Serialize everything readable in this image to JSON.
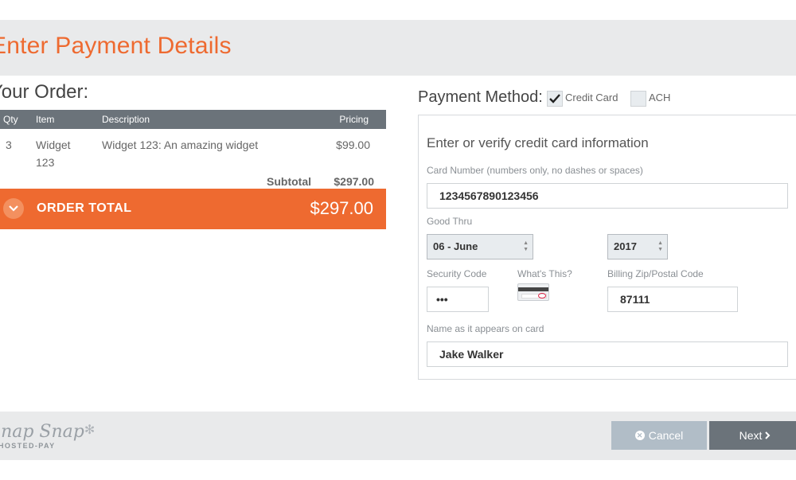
{
  "header": {
    "title": "Enter Payment Details"
  },
  "order": {
    "heading": "Your Order:",
    "columns": {
      "qty": "Qty",
      "item": "Item",
      "description": "Description",
      "pricing": "Pricing"
    },
    "rows": [
      {
        "qty": "3",
        "item_line1": "Widget",
        "item_line2": "123",
        "description": "Widget 123: An amazing widget",
        "price": "$99.00"
      }
    ],
    "subtotal_label": "Subtotal",
    "subtotal_value": "$297.00",
    "total_label": "ORDER TOTAL",
    "total_value": "$297.00",
    "expand_icon": "chevron-down-icon"
  },
  "payment": {
    "label": "Payment Method:",
    "options": [
      {
        "label": "Credit Card",
        "checked": true
      },
      {
        "label": "ACH",
        "checked": false
      }
    ]
  },
  "card_form": {
    "heading": "Enter or verify credit card information",
    "card_number_label": "Card Number (numbers only, no dashes or spaces)",
    "card_number_value": "1234567890123456",
    "good_thru_label": "Good Thru",
    "month_value": "06 - June",
    "year_value": "2017",
    "security_code_label": "Security Code",
    "security_code_value": "•••",
    "whats_this_label": "What's This?",
    "zip_label": "Billing Zip/Postal Code",
    "zip_value": "87111",
    "name_label": "Name as it appears on card",
    "name_value": "Jake Walker"
  },
  "footer": {
    "logo_text": "Snap Snap",
    "logo_sub": "HOSTED-PAY",
    "cancel_label": "Cancel",
    "next_label": "Next",
    "cancel_icon": "x-circle-icon",
    "next_icon": "chevron-right-icon"
  },
  "colors": {
    "accent": "#ee6a30",
    "header_bg": "#e9eaeb",
    "table_head": "#6b737a",
    "cancel_bg": "#b1bdc7"
  }
}
